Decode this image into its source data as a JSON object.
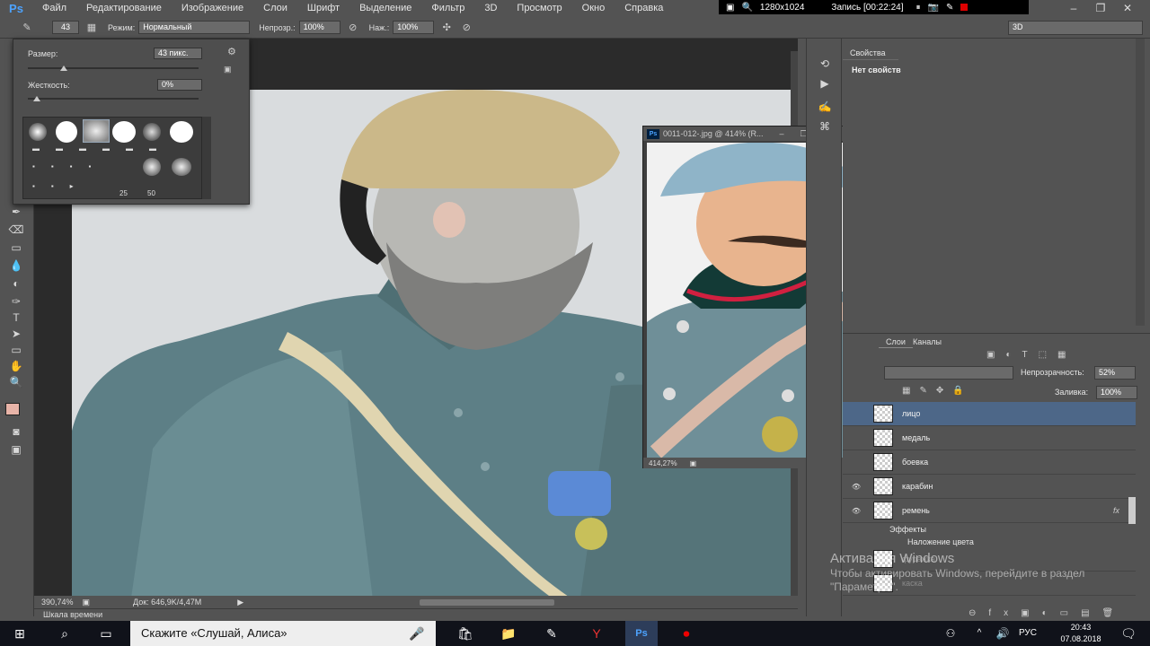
{
  "app": {
    "logo": "Ps",
    "menu": [
      "Файл",
      "Редактирование",
      "Изображение",
      "Слои",
      "Шрифт",
      "Выделение",
      "Фильтр",
      "3D",
      "Просмотр",
      "Окно",
      "Справка"
    ]
  },
  "recorder": {
    "resolution": "1280x1024",
    "record_label": "Запись [00:22:24]"
  },
  "options_bar": {
    "brush_size": "43",
    "mode_label": "Режим:",
    "mode_value": "Нормальный",
    "opacity_label": "Непрозр.:",
    "opacity_value": "100%",
    "flow_label": "Наж.:",
    "flow_value": "100%",
    "workspace": "3D"
  },
  "brush_popup": {
    "size_label": "Размер:",
    "size_value": "43 пикс.",
    "size_fraction": 0.21,
    "hardness_label": "Жесткость:",
    "hardness_value": "0%",
    "hardness_fraction": 0.0,
    "tip_numbers": [
      "25",
      "50"
    ]
  },
  "document": {
    "zoom": "390,74%",
    "doc_info": "Док: 646,9K/4,47M",
    "timeline_label": "Шкала времени"
  },
  "floating_doc": {
    "logo": "Ps",
    "title": "0011-012-.jpg @ 414% (R...",
    "zoom": "414,27%"
  },
  "properties": {
    "tab": "Свойства",
    "body": "Нет свойств"
  },
  "layers_panel": {
    "tab_layers": "Слои",
    "tab_channels": "Каналы",
    "opacity_label": "Непрозрачность:",
    "opacity_value": "52%",
    "fill_label": "Заливка:",
    "fill_value": "100%",
    "layers": [
      {
        "name": "лицо",
        "selected": true,
        "eye": ""
      },
      {
        "name": "медаль",
        "selected": false,
        "eye": ""
      },
      {
        "name": "боевка",
        "selected": false,
        "eye": ""
      },
      {
        "name": "карабин",
        "selected": false,
        "eye": "👁"
      },
      {
        "name": "ремень",
        "selected": false,
        "eye": "👁",
        "fx": "fx"
      }
    ],
    "effects_label": "Эффекты",
    "effect_item": "Наложение цвета",
    "more_layers": [
      "фуражка",
      "каска"
    ]
  },
  "taskbar": {
    "search_text": "Скажите «Слушай, Алиса»",
    "lang": "РУС",
    "time": "20:43",
    "date": "07.08.2018"
  },
  "watermark": {
    "line1": "Активация Windows",
    "line2": "Чтобы активировать Windows, перейдите в раздел \"Параметры\"."
  }
}
